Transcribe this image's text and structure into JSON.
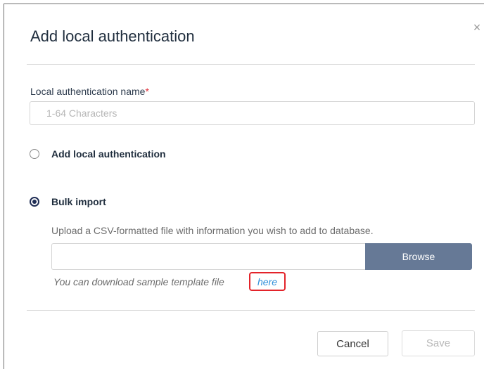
{
  "dialog": {
    "title": "Add local authentication",
    "close_icon": "close-icon",
    "close_glyph": "×"
  },
  "name_field": {
    "label": "Local authentication name",
    "required_mark": "*",
    "placeholder": "1-64 Characters",
    "value": ""
  },
  "options": {
    "add_local": {
      "label": "Add local authentication",
      "selected": false
    },
    "bulk_import": {
      "label": "Bulk import",
      "selected": true
    }
  },
  "bulk": {
    "hint": "Upload a CSV-formatted file with information you wish to add to database.",
    "file_value": "",
    "browse_label": "Browse",
    "download_text": "You can download sample template file",
    "here_link": "here"
  },
  "footer": {
    "cancel_label": "Cancel",
    "save_label": "Save",
    "save_disabled": true
  },
  "colors": {
    "title_text": "#1f2d3d",
    "required": "#e0303a",
    "browse_bg": "#667996",
    "link": "#2f8fd9",
    "highlight_box": "#e3232a",
    "radio_selected": "#1f2d55"
  }
}
